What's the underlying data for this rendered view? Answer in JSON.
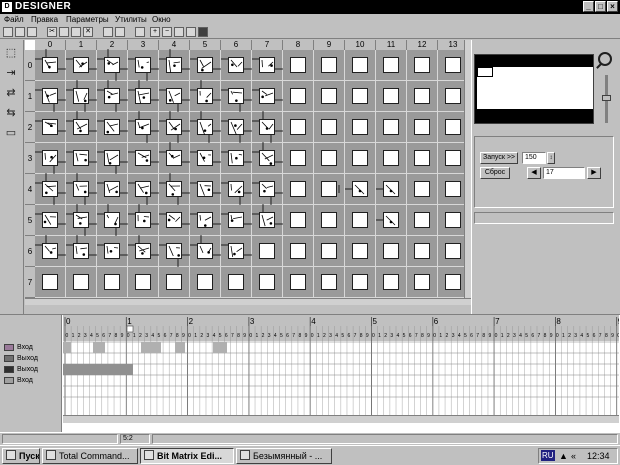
{
  "window": {
    "title": "DESIGNER",
    "icon_letter": "D",
    "min": "_",
    "max": "□",
    "close": "×"
  },
  "menu": [
    "Файл",
    "Правка",
    "Параметры",
    "Утилиты",
    "Окно"
  ],
  "grid": {
    "columns": [
      "0",
      "1",
      "2",
      "3",
      "4",
      "5",
      "6",
      "7",
      "8",
      "9",
      "10",
      "11",
      "12",
      "13"
    ],
    "rows": [
      "0",
      "1",
      "2",
      "3",
      "4",
      "5",
      "6",
      "7"
    ]
  },
  "control": {
    "start_label": "Запуск >>",
    "start_value": "150",
    "reset_label": "Сброс",
    "step_value": "17"
  },
  "timeline": {
    "major_ticks": [
      "0",
      "1",
      "2",
      "3",
      "4",
      "5",
      "6",
      "7",
      "8",
      "9"
    ],
    "signals": [
      {
        "label": "Вход",
        "color": "#9a7a9a"
      },
      {
        "label": "Выход",
        "color": "#707070"
      },
      {
        "label": "Выход",
        "color": "#303030"
      },
      {
        "label": "Вход",
        "color": "#a0a0a0"
      }
    ]
  },
  "status": {
    "position": "5:2"
  },
  "taskbar": {
    "start": "Пуск",
    "tasks": [
      "Total Command...",
      "Bit Matrix Edi...",
      "Безымянный - ..."
    ],
    "lang": "RU",
    "clock": "12:34"
  }
}
